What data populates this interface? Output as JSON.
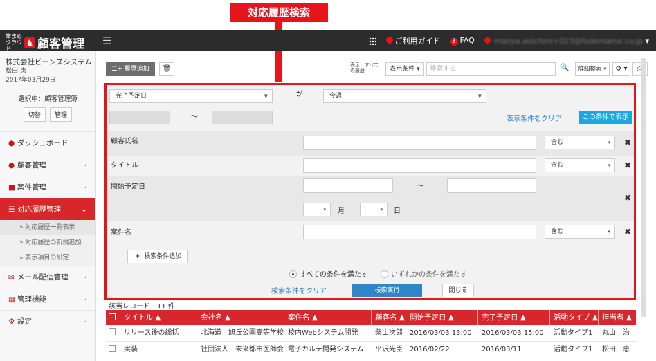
{
  "callout": {
    "label": "対応履歴検索"
  },
  "topbar": {
    "logo_small": "筆まめ クラウド",
    "logo_text": "顧客管理",
    "guide": "ご利用ガイド",
    "faq": "FAQ",
    "user_email": "manya.aoichiro+023@fudemame.co.jp"
  },
  "sidebar": {
    "company": "株式会社ビーンズシステム",
    "user": "松田 恵",
    "date": "2017年03月29日",
    "selecting": "選択中：顧客管理簿",
    "switch_btn": "切替",
    "manage_btn": "管理",
    "items": [
      {
        "label": "ダッシュボード",
        "icon": "dashboard-icon"
      },
      {
        "label": "顧客管理",
        "icon": "users-icon"
      },
      {
        "label": "案件管理",
        "icon": "case-icon"
      },
      {
        "label": "対応履歴管理",
        "icon": "list-icon"
      },
      {
        "label": "メール配信管理",
        "icon": "mail-icon"
      },
      {
        "label": "管理機能",
        "icon": "grid-icon"
      },
      {
        "label": "設定",
        "icon": "gear-icon"
      }
    ],
    "subitems": [
      "» 対応履歴一覧表示",
      "» 対応履歴の新規追加",
      "» 表示項目の設定"
    ]
  },
  "toolbar": {
    "add_history": "履歴追加",
    "display_label": "表示：すべての履歴",
    "display_condition": "表示条件",
    "search_placeholder": "検索する",
    "detail_search": "詳細検索"
  },
  "panel": {
    "field_select": "完了予定日",
    "ga": "が",
    "value_select": "今週",
    "tilde": "～",
    "clear_display": "表示条件をクリア",
    "show_with_condition": "この条件で表示",
    "rows": [
      {
        "label": "顧客氏名",
        "match": "含む"
      },
      {
        "label": "タイトル",
        "match": "含む"
      },
      {
        "label": "開始予定日"
      },
      {
        "label": "案件名",
        "match": "含む"
      }
    ],
    "month": "月",
    "day": "日",
    "add_condition": "検索条件追加",
    "all_conditions": "すべての条件を満たす",
    "any_condition": "いずれかの条件を満たす",
    "clear_search": "検索条件をクリア",
    "execute": "検索実行",
    "close": "閉じる"
  },
  "records": {
    "count_label": "該当レコード　11 件",
    "columns": [
      "タイトル ▲",
      "会社名 ▲",
      "案件名 ▲",
      "顧客名 ▲",
      "開始予定日 ▲",
      "完了予定日 ▲",
      "活動タイプ ▲",
      "担当者 ▲"
    ],
    "rows": [
      [
        "リリース後の総括",
        "北海道　旭丘公園高等学校",
        "校内Webシステム開発",
        "柴山次郎",
        "2016/03/03 13:00",
        "2016/03/03 15:00",
        "活動タイプ1",
        "丸山　治"
      ],
      [
        "実装",
        "社団法人　未来都市医師会",
        "電子カルテ開発システム",
        "平沢光臣",
        "2016/02/22",
        "2016/03/11",
        "活動タイプ1",
        "松田　恵"
      ]
    ]
  }
}
